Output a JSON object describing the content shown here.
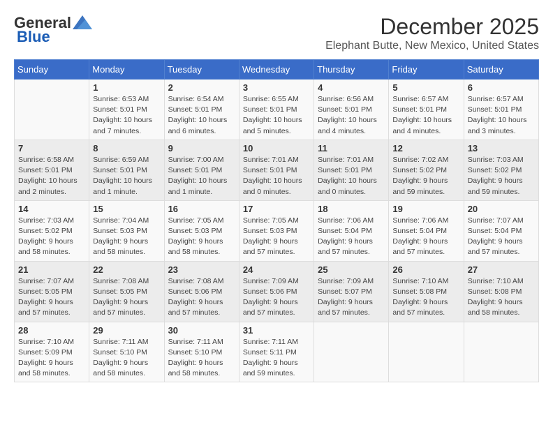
{
  "logo": {
    "general": "General",
    "blue": "Blue"
  },
  "title": {
    "month": "December 2025",
    "location": "Elephant Butte, New Mexico, United States"
  },
  "headers": [
    "Sunday",
    "Monday",
    "Tuesday",
    "Wednesday",
    "Thursday",
    "Friday",
    "Saturday"
  ],
  "weeks": [
    [
      {
        "day": "",
        "info": ""
      },
      {
        "day": "1",
        "info": "Sunrise: 6:53 AM\nSunset: 5:01 PM\nDaylight: 10 hours\nand 7 minutes."
      },
      {
        "day": "2",
        "info": "Sunrise: 6:54 AM\nSunset: 5:01 PM\nDaylight: 10 hours\nand 6 minutes."
      },
      {
        "day": "3",
        "info": "Sunrise: 6:55 AM\nSunset: 5:01 PM\nDaylight: 10 hours\nand 5 minutes."
      },
      {
        "day": "4",
        "info": "Sunrise: 6:56 AM\nSunset: 5:01 PM\nDaylight: 10 hours\nand 4 minutes."
      },
      {
        "day": "5",
        "info": "Sunrise: 6:57 AM\nSunset: 5:01 PM\nDaylight: 10 hours\nand 4 minutes."
      },
      {
        "day": "6",
        "info": "Sunrise: 6:57 AM\nSunset: 5:01 PM\nDaylight: 10 hours\nand 3 minutes."
      }
    ],
    [
      {
        "day": "7",
        "info": "Sunrise: 6:58 AM\nSunset: 5:01 PM\nDaylight: 10 hours\nand 2 minutes."
      },
      {
        "day": "8",
        "info": "Sunrise: 6:59 AM\nSunset: 5:01 PM\nDaylight: 10 hours\nand 1 minute."
      },
      {
        "day": "9",
        "info": "Sunrise: 7:00 AM\nSunset: 5:01 PM\nDaylight: 10 hours\nand 1 minute."
      },
      {
        "day": "10",
        "info": "Sunrise: 7:01 AM\nSunset: 5:01 PM\nDaylight: 10 hours\nand 0 minutes."
      },
      {
        "day": "11",
        "info": "Sunrise: 7:01 AM\nSunset: 5:01 PM\nDaylight: 10 hours\nand 0 minutes."
      },
      {
        "day": "12",
        "info": "Sunrise: 7:02 AM\nSunset: 5:02 PM\nDaylight: 9 hours\nand 59 minutes."
      },
      {
        "day": "13",
        "info": "Sunrise: 7:03 AM\nSunset: 5:02 PM\nDaylight: 9 hours\nand 59 minutes."
      }
    ],
    [
      {
        "day": "14",
        "info": "Sunrise: 7:03 AM\nSunset: 5:02 PM\nDaylight: 9 hours\nand 58 minutes."
      },
      {
        "day": "15",
        "info": "Sunrise: 7:04 AM\nSunset: 5:03 PM\nDaylight: 9 hours\nand 58 minutes."
      },
      {
        "day": "16",
        "info": "Sunrise: 7:05 AM\nSunset: 5:03 PM\nDaylight: 9 hours\nand 58 minutes."
      },
      {
        "day": "17",
        "info": "Sunrise: 7:05 AM\nSunset: 5:03 PM\nDaylight: 9 hours\nand 57 minutes."
      },
      {
        "day": "18",
        "info": "Sunrise: 7:06 AM\nSunset: 5:04 PM\nDaylight: 9 hours\nand 57 minutes."
      },
      {
        "day": "19",
        "info": "Sunrise: 7:06 AM\nSunset: 5:04 PM\nDaylight: 9 hours\nand 57 minutes."
      },
      {
        "day": "20",
        "info": "Sunrise: 7:07 AM\nSunset: 5:04 PM\nDaylight: 9 hours\nand 57 minutes."
      }
    ],
    [
      {
        "day": "21",
        "info": "Sunrise: 7:07 AM\nSunset: 5:05 PM\nDaylight: 9 hours\nand 57 minutes."
      },
      {
        "day": "22",
        "info": "Sunrise: 7:08 AM\nSunset: 5:05 PM\nDaylight: 9 hours\nand 57 minutes."
      },
      {
        "day": "23",
        "info": "Sunrise: 7:08 AM\nSunset: 5:06 PM\nDaylight: 9 hours\nand 57 minutes."
      },
      {
        "day": "24",
        "info": "Sunrise: 7:09 AM\nSunset: 5:06 PM\nDaylight: 9 hours\nand 57 minutes."
      },
      {
        "day": "25",
        "info": "Sunrise: 7:09 AM\nSunset: 5:07 PM\nDaylight: 9 hours\nand 57 minutes."
      },
      {
        "day": "26",
        "info": "Sunrise: 7:10 AM\nSunset: 5:08 PM\nDaylight: 9 hours\nand 57 minutes."
      },
      {
        "day": "27",
        "info": "Sunrise: 7:10 AM\nSunset: 5:08 PM\nDaylight: 9 hours\nand 58 minutes."
      }
    ],
    [
      {
        "day": "28",
        "info": "Sunrise: 7:10 AM\nSunset: 5:09 PM\nDaylight: 9 hours\nand 58 minutes."
      },
      {
        "day": "29",
        "info": "Sunrise: 7:11 AM\nSunset: 5:10 PM\nDaylight: 9 hours\nand 58 minutes."
      },
      {
        "day": "30",
        "info": "Sunrise: 7:11 AM\nSunset: 5:10 PM\nDaylight: 9 hours\nand 58 minutes."
      },
      {
        "day": "31",
        "info": "Sunrise: 7:11 AM\nSunset: 5:11 PM\nDaylight: 9 hours\nand 59 minutes."
      },
      {
        "day": "",
        "info": ""
      },
      {
        "day": "",
        "info": ""
      },
      {
        "day": "",
        "info": ""
      }
    ]
  ]
}
